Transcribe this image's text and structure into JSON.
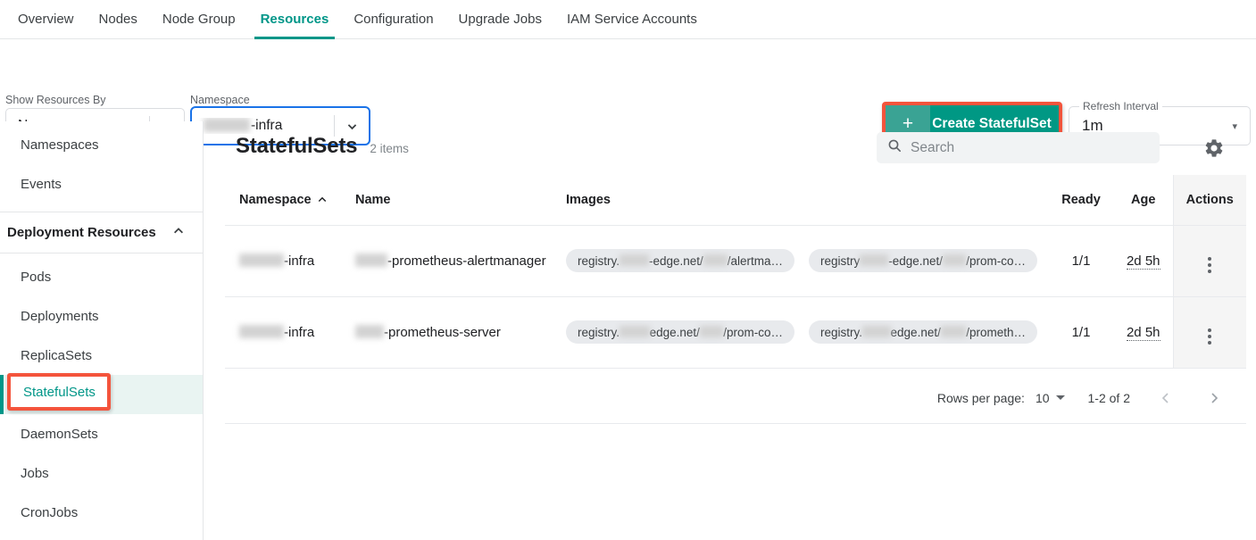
{
  "tabs": [
    {
      "label": "Overview",
      "active": false
    },
    {
      "label": "Nodes",
      "active": false
    },
    {
      "label": "Node Group",
      "active": false
    },
    {
      "label": "Resources",
      "active": true
    },
    {
      "label": "Configuration",
      "active": false
    },
    {
      "label": "Upgrade Jobs",
      "active": false
    },
    {
      "label": "IAM Service Accounts",
      "active": false
    }
  ],
  "filters": {
    "show_by_label": "Show Resources By",
    "show_by_value": "Namespaces",
    "namespace_label": "Namespace",
    "namespace_value_suffix": "-infra",
    "namespace_value_redacted": true,
    "create_button_label": "Create StatefulSet",
    "create_button_plus": "+",
    "refresh_label": "Refresh Interval",
    "refresh_value": "1m"
  },
  "sidebar": {
    "top_items": [
      {
        "label": "Namespaces",
        "selected": false
      },
      {
        "label": "Events",
        "selected": false
      }
    ],
    "section_title": "Deployment Resources",
    "section_expanded": true,
    "items": [
      {
        "label": "Pods",
        "selected": false
      },
      {
        "label": "Deployments",
        "selected": false
      },
      {
        "label": "ReplicaSets",
        "selected": false
      },
      {
        "label": "StatefulSets",
        "selected": true
      },
      {
        "label": "DaemonSets",
        "selected": false
      },
      {
        "label": "Jobs",
        "selected": false
      },
      {
        "label": "CronJobs",
        "selected": false
      }
    ]
  },
  "main": {
    "title": "StatefulSets",
    "item_count": "2 items",
    "search_placeholder": "Search",
    "search_value": "",
    "columns": [
      {
        "label": "Namespace",
        "sorted": "asc"
      },
      {
        "label": "Name",
        "sorted": ""
      },
      {
        "label": "Images",
        "sorted": ""
      },
      {
        "label": "Ready",
        "sorted": ""
      },
      {
        "label": "Age",
        "sorted": ""
      },
      {
        "label": "Actions",
        "sorted": ""
      }
    ],
    "rows": [
      {
        "namespace_suffix": "-infra",
        "name_suffix": "-prometheus-alertmanager",
        "images": [
          {
            "prefix": "registry.",
            "mid": "-edge.net/",
            "suffix": "/alertma…"
          },
          {
            "prefix": "registry",
            "mid": "-edge.net/",
            "suffix": "/prom-co…"
          }
        ],
        "ready": "1/1",
        "age": "2d 5h"
      },
      {
        "namespace_suffix": "-infra",
        "name_suffix": "-prometheus-server",
        "images": [
          {
            "prefix": "registry.",
            "mid": "edge.net/",
            "suffix": "/prom-co…"
          },
          {
            "prefix": "registry.",
            "mid": "edge.net/",
            "suffix": "/prometh…"
          }
        ],
        "ready": "1/1",
        "age": "2d 5h"
      }
    ],
    "pagination": {
      "rows_per_page_label": "Rows per page:",
      "rows_per_page_value": "10",
      "range_label": "1-2 of 2",
      "prev_label": "‹",
      "next_label": "›"
    }
  },
  "colors": {
    "accent_teal": "#009688",
    "button_teal": "#009884",
    "highlight_red": "#f4543c",
    "focus_blue": "#1a73e8",
    "selected_bg": "#e9f4f2"
  }
}
